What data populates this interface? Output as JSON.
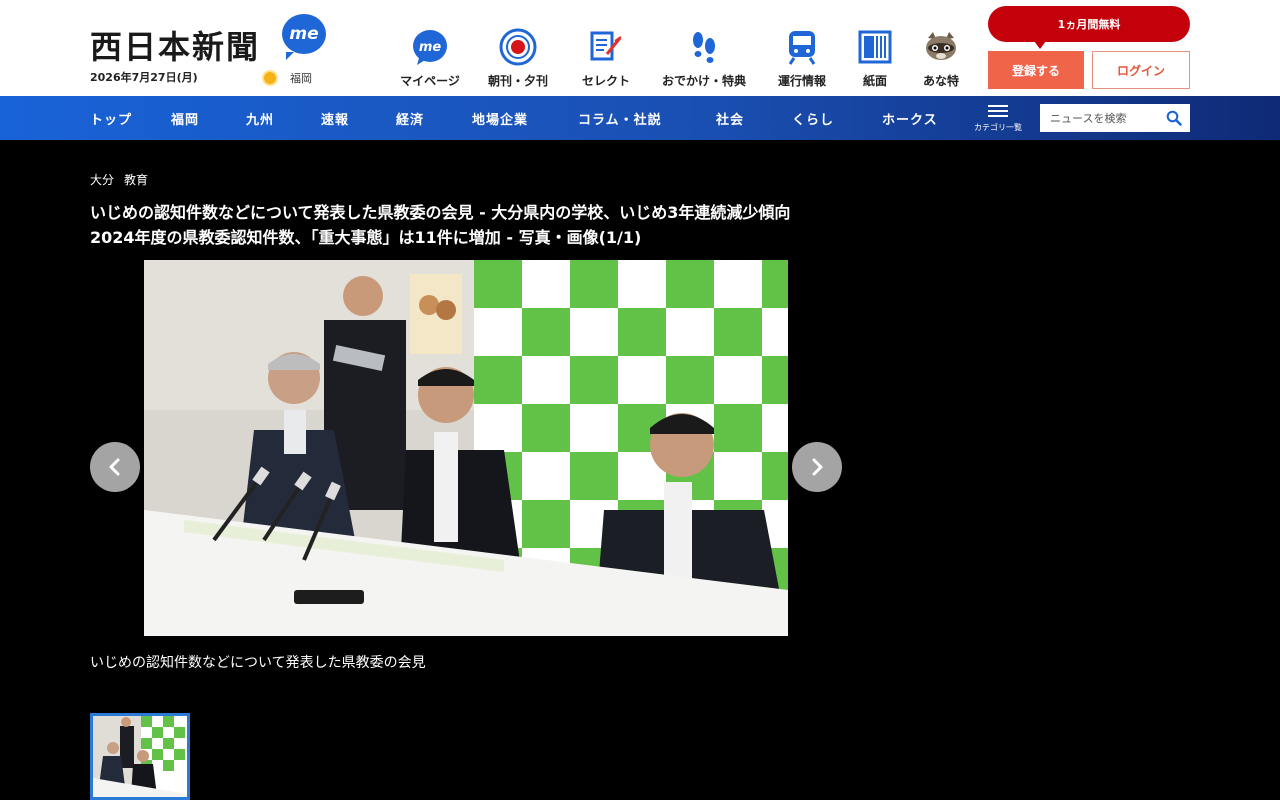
{
  "header": {
    "logo": "西日本新聞",
    "me_badge": "me",
    "date": "2026年7月27日(月)",
    "weather_location": "福岡",
    "nav_icons": [
      {
        "label": "マイページ",
        "icon": "me-icon"
      },
      {
        "label": "朝刊・夕刊",
        "icon": "newspaper-circle-icon"
      },
      {
        "label": "セレクト",
        "icon": "select-pen-icon"
      },
      {
        "label": "おでかけ・特典",
        "icon": "footprints-icon"
      },
      {
        "label": "運行情報",
        "icon": "train-icon"
      },
      {
        "label": "紙面",
        "icon": "paper-icon"
      },
      {
        "label": "あな特",
        "icon": "raccoon-icon"
      }
    ],
    "promo": "1ヵ月間無料",
    "register": "登録する",
    "login": "ログイン"
  },
  "categories": [
    "トップ",
    "福岡",
    "九州",
    "速報",
    "経済",
    "地場企業",
    "コラム・社説",
    "社会",
    "くらし",
    "ホークス"
  ],
  "menu_label": "カテゴリ一覧",
  "search": {
    "placeholder": "ニュースを検索"
  },
  "article": {
    "breadcrumb": [
      "大分",
      "教育"
    ],
    "title": "いじめの認知件数などについて発表した県教委の会見 - 大分県内の学校、いじめ3年連続減少傾向　2024年度の県教委認知件数、「重大事態」は11件に増加 - 写真・画像(1/1)",
    "caption": "いじめの認知件数などについて発表した県教委の会見"
  },
  "colors": {
    "accent_blue": "#1963d8",
    "brand_red": "#c4000b",
    "register_orange": "#f0644a"
  }
}
